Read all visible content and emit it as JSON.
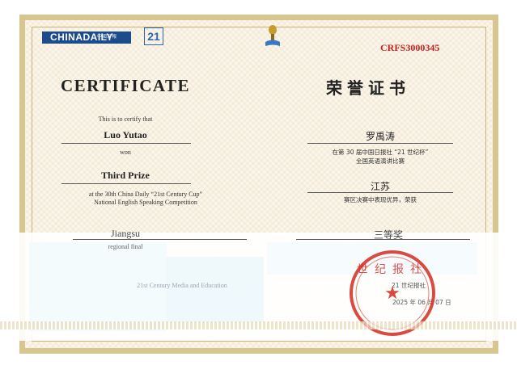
{
  "header": {
    "logo_text": "CHINADAILY",
    "logo_sub": "中國日報",
    "logo_21": "21",
    "serial": "CRFS3000345"
  },
  "title": {
    "en": "CERTIFICATE",
    "zh": "荣誉证书"
  },
  "english": {
    "certify": "This is to certify that",
    "name": "Luo Yutao",
    "won": "won",
    "prize": "Third Prize",
    "event_line1": "at the 30th China Daily “21st Century Cup”",
    "event_line2": "National English Speaking Competition",
    "region": "Jiangsu",
    "region_final": "regional final",
    "issuer": "21st Century Media and Education"
  },
  "chinese": {
    "name": "罗禹涛",
    "event_line1": "在第 30 届中国日报社 “21 世纪杯”",
    "event_line2": "全国英语演讲比赛",
    "region": "江苏",
    "performance": "赛区决赛中表现优异，荣获",
    "prize": "三等奖",
    "issuer": "21 世纪报社",
    "date": "2025 年 06 月 07 日"
  },
  "seal": {
    "text": "世纪报社",
    "star": "★"
  },
  "colors": {
    "frame": "#d8c690",
    "seal": "#d42a20",
    "serial": "#c8201e",
    "logo": "#1d4c8c"
  }
}
